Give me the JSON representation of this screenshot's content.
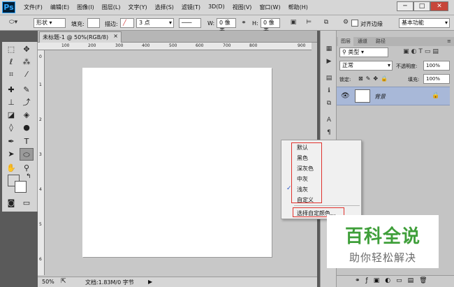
{
  "app": {
    "logo": "Ps"
  },
  "menu": [
    "文件(F)",
    "编辑(E)",
    "图像(I)",
    "图层(L)",
    "文字(Y)",
    "选择(S)",
    "滤镜(T)",
    "3D(D)",
    "视图(V)",
    "窗口(W)",
    "帮助(H)"
  ],
  "window_controls": {
    "minimize": "─",
    "restore": "□",
    "close": "✕"
  },
  "options": {
    "mode": "形状",
    "fill_label": "填充:",
    "stroke_label": "描边:",
    "stroke_size": "3 点",
    "w_label": "W:",
    "w_value": "0 像素",
    "h_label": "H:",
    "h_value": "0 像素",
    "align_edges": "对齐边缘",
    "workspace": "基本功能"
  },
  "document": {
    "tab_title": "未标题-1 @ 50%(RGB/8)",
    "tab_close": "×",
    "ruler_h": [
      "100",
      "200",
      "300",
      "400",
      "500",
      "600",
      "700",
      "800",
      "900"
    ],
    "ruler_v": [
      "0",
      "1",
      "2",
      "3",
      "4",
      "5",
      "6"
    ],
    "zoom": "50%",
    "doc_info": "文档:1.83M/0 字节"
  },
  "panel": {
    "tabs": [
      "图层",
      "通道",
      "路径"
    ],
    "filter_label": "类型",
    "blend_mode": "正常",
    "opacity_label": "不透明度:",
    "opacity_value": "100%",
    "lock_label": "锁定:",
    "fill_label": "填充:",
    "fill_value": "100%",
    "layer_name": "背景"
  },
  "context_menu": {
    "items": [
      "默认",
      "黑色",
      "深灰色",
      "中灰",
      "浅灰",
      "自定义"
    ],
    "checked_index": 4,
    "checkmark": "✓",
    "custom_color": "选择自定颜色..."
  },
  "watermark": {
    "title": "百科全说",
    "subtitle": "助你轻松解决"
  },
  "colors": {
    "highlight": "#e0312c",
    "layer_selected": "#a8b8d8",
    "watermark_green": "#3f9f3a"
  }
}
